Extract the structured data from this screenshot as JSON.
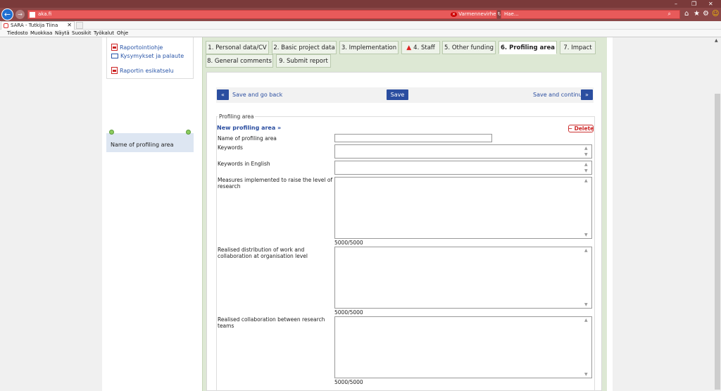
{
  "browser": {
    "url_domain": "aka.fi",
    "cert_error": "Varmennevirhe",
    "search_placeholder": "Hae...",
    "tab_title": "SARA - Tutkija Tiina",
    "menu": [
      "Tiedosto",
      "Muokkaa",
      "Näytä",
      "Suosikit",
      "Työkalut",
      "Ohje"
    ]
  },
  "sidebar": {
    "links": [
      {
        "label": "Raportointiohje",
        "icon": "pdf-icon"
      },
      {
        "label": "Kysymykset ja palaute",
        "icon": "mail-icon"
      },
      {
        "label": "Raportin esikatselu",
        "icon": "pdf-icon"
      }
    ],
    "nav_item": "Name of profiling area"
  },
  "tabs": [
    {
      "label": "1. Personal data/CV"
    },
    {
      "label": "2. Basic project data"
    },
    {
      "label": "3. Implementation"
    },
    {
      "label": "4. Staff",
      "warning": true
    },
    {
      "label": "5. Other funding"
    },
    {
      "label": "6. Profiling area",
      "active": true
    },
    {
      "label": "7. Impact"
    },
    {
      "label": "8. General comments"
    },
    {
      "label": "9. Submit report"
    }
  ],
  "actions": {
    "back_arrow": "«",
    "save_back": "Save and go back",
    "save": "Save",
    "save_continue": "Save and continue",
    "forward_arrow": "»"
  },
  "form": {
    "legend": "Profiling area",
    "new_area": "New profiling area »",
    "delete": "Delete",
    "fields": {
      "name": "Name of profiling area",
      "keywords": "Keywords",
      "keywords_en": "Keywords in English",
      "measures": "Measures implemented to raise the level of research",
      "distribution": "Realised distribution of work and collaboration at organisation level",
      "collaboration": "Realised collaboration between research teams"
    },
    "counters": {
      "measures": "5000/5000",
      "distribution": "5000/5000",
      "collaboration": "5000/5000"
    }
  },
  "colors": {
    "accent_blue": "#2b4ea0",
    "panel_green": "#dde8d4",
    "addressbar_red": "#e85a5a"
  }
}
